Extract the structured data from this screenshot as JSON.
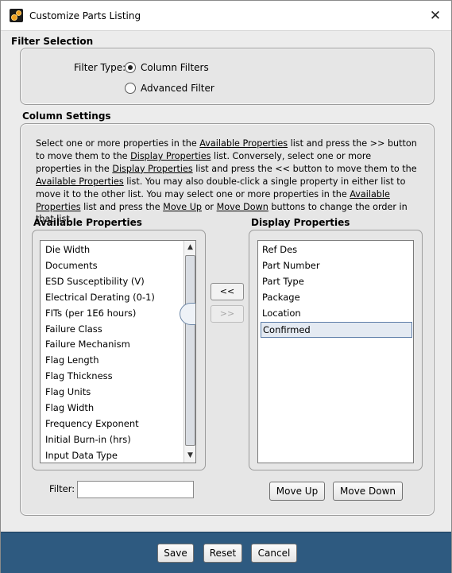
{
  "window": {
    "title": "Customize Parts Listing",
    "close_glyph": "✕"
  },
  "filter_selection": {
    "heading": "Filter Selection",
    "filter_type_label": "Filter Type:",
    "options": [
      {
        "label": "Column Filters",
        "checked": true
      },
      {
        "label": "Advanced Filter",
        "checked": false
      }
    ]
  },
  "column_settings": {
    "heading": "Column Settings",
    "description": [
      {
        "t": "Select one or more properties in the "
      },
      {
        "t": "Available Properties",
        "u": true
      },
      {
        "t": " list and press the >> button to move them to the "
      },
      {
        "t": "Display Properties",
        "u": true
      },
      {
        "t": " list. Conversely, select one or more properties in the "
      },
      {
        "t": "Display Properties",
        "u": true
      },
      {
        "t": " list and press the << button to move them to the "
      },
      {
        "t": "Available Properties",
        "u": true
      },
      {
        "t": " list. You may also double-click a single property in either list to move it to the other list. You may select one or more properties in the "
      },
      {
        "t": "Available Properties",
        "u": true
      },
      {
        "t": " list and press the "
      },
      {
        "t": "Move Up",
        "u": true
      },
      {
        "t": " or "
      },
      {
        "t": "Move Down",
        "u": true
      },
      {
        "t": " buttons to change the order in that list."
      }
    ],
    "available": {
      "heading": "Available Properties",
      "items": [
        "Die Width",
        "Documents",
        "ESD Susceptibility (V)",
        "Electrical Derating (0-1)",
        "FITs (per 1E6 hours)",
        "Failure Class",
        "Failure Mechanism",
        "Flag Length",
        "Flag Thickness",
        "Flag Units",
        "Flag Width",
        "Frequency Exponent",
        "Initial Burn-in (hrs)",
        "Input Data Type"
      ],
      "scroll_position": 0.3
    },
    "display": {
      "heading": "Display Properties",
      "items": [
        "Ref Des",
        "Part Number",
        "Part Type",
        "Package",
        "Location",
        "Confirmed"
      ],
      "selected_index": 5
    },
    "move_left_label": "<<",
    "move_right_label": ">>",
    "filter_label": "Filter:",
    "filter_value": "",
    "move_up_label": "Move Up",
    "move_down_label": "Move Down"
  },
  "footer": {
    "save_label": "Save",
    "reset_label": "Reset",
    "cancel_label": "Cancel"
  },
  "colors": {
    "footer_bg": "#2e5a80",
    "selection_bg": "#e4eaf2",
    "selection_border": "#5e7ea8"
  }
}
